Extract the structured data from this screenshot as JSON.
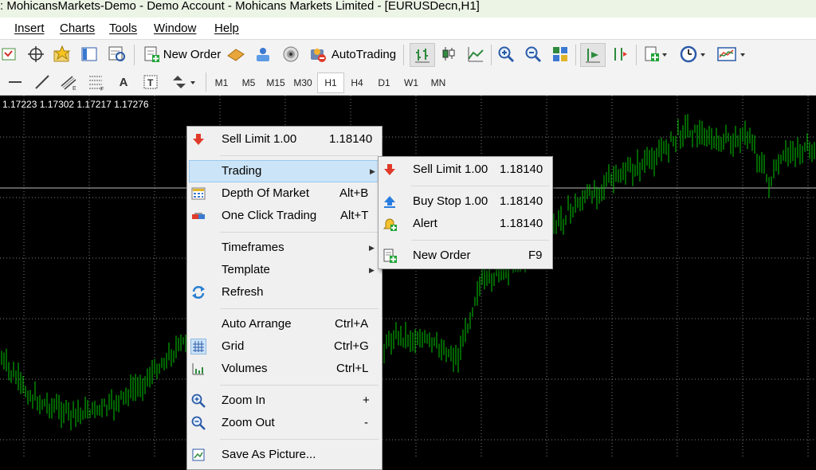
{
  "window": {
    "title": ": MohicansMarkets-Demo - Demo Account - Mohicans Markets Limited - [EURUSDecn,H1]"
  },
  "menubar": {
    "items": [
      "Insert",
      "Charts",
      "Tools",
      "Window",
      "Help"
    ]
  },
  "toolbar": {
    "new_order": "New Order",
    "autotrading": "AutoTrading"
  },
  "drawing_toolbar": {
    "text_tool": "A"
  },
  "timeframes": {
    "items": [
      "M1",
      "M5",
      "M15",
      "M30",
      "H1",
      "H4",
      "D1",
      "W1",
      "MN"
    ],
    "active": "H1"
  },
  "chart": {
    "ohlc": "1.17223 1.17302 1.17217 1.17276",
    "candle_color": "#00c800",
    "grid_color": "#7f7f7f",
    "chart_data": {
      "type": "bar",
      "symbol": "EURUSDecn",
      "timeframe": "H1",
      "open": 1.17223,
      "high": 1.17302,
      "low": 1.17217,
      "close": 1.17276
    }
  },
  "context_menu": {
    "sell_limit": {
      "label": "Sell Limit 1.00",
      "value": "1.18140"
    },
    "trading": "Trading",
    "depth_of_market": {
      "label": "Depth Of Market",
      "shortcut": "Alt+B"
    },
    "one_click_trading": {
      "label": "One Click Trading",
      "shortcut": "Alt+T"
    },
    "timeframes": "Timeframes",
    "template": "Template",
    "refresh": "Refresh",
    "auto_arrange": {
      "label": "Auto Arrange",
      "shortcut": "Ctrl+A"
    },
    "grid": {
      "label": "Grid",
      "shortcut": "Ctrl+G"
    },
    "volumes": {
      "label": "Volumes",
      "shortcut": "Ctrl+L"
    },
    "zoom_in": {
      "label": "Zoom In",
      "shortcut": "+"
    },
    "zoom_out": {
      "label": "Zoom Out",
      "shortcut": "-"
    },
    "save_as_picture": "Save As Picture..."
  },
  "trading_submenu": {
    "sell_limit": {
      "label": "Sell Limit 1.00",
      "value": "1.18140"
    },
    "buy_stop": {
      "label": "Buy Stop 1.00",
      "value": "1.18140"
    },
    "alert": {
      "label": "Alert",
      "value": "1.18140"
    },
    "new_order": {
      "label": "New Order",
      "shortcut": "F9"
    }
  },
  "colors": {
    "sell": "#e03a2a",
    "buy": "#2a7de0",
    "highlight": "#cce4f7",
    "menu_bg": "#f0f0f0"
  }
}
